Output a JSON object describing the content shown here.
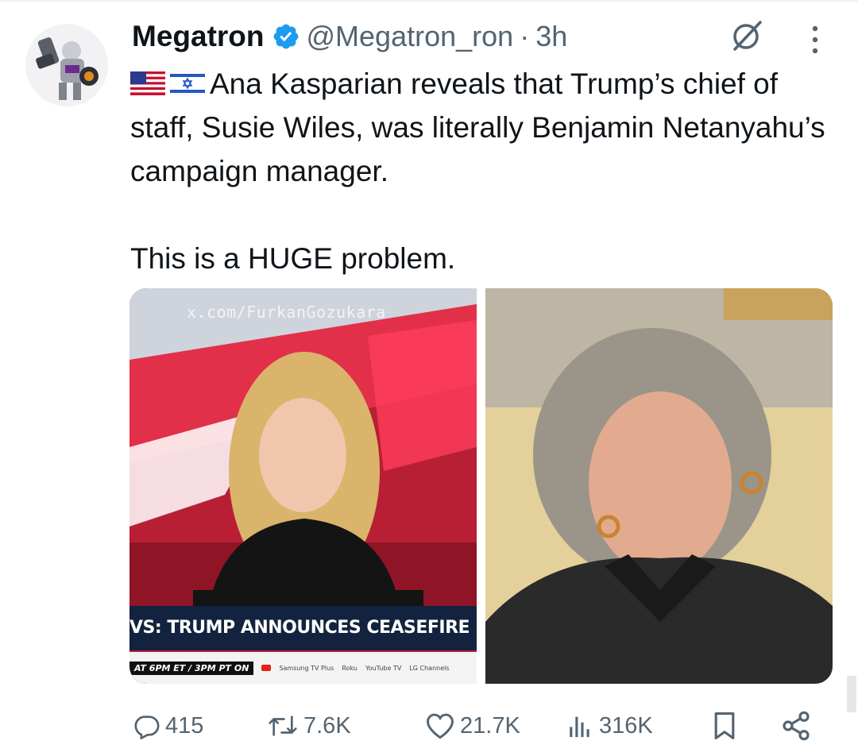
{
  "tweet": {
    "author_name": "Megatron",
    "handle": "@Megatron_ron",
    "separator": "·",
    "time": "3h",
    "text_line1": "Ana Kasparian reveals that Trump’s chief of staff, Susie Wiles, was literally Benjamin Netanyahu’s campaign manager.",
    "text_line2": "This is a HUGE problem.",
    "flags": [
      "us-flag-icon",
      "israel-flag-icon"
    ]
  },
  "media": {
    "left": {
      "watermark": "x.com/FurkanGozukara",
      "lower_third": "VS: TRUMP ANNOUNCES CEASEFIRE EXTE",
      "ticker_time": "AT 6PM ET / 3PM PT ON",
      "ticker_logos": [
        "Samsung TV Plus",
        "Roku",
        "YouTube TV",
        "LG Channels"
      ]
    }
  },
  "actions": {
    "replies": "415",
    "reposts": "7.6K",
    "likes": "21.7K",
    "views": "316K"
  },
  "colors": {
    "verified": "#1d9bf0",
    "secondary_text": "#536471",
    "primary_text": "#0f1419"
  }
}
